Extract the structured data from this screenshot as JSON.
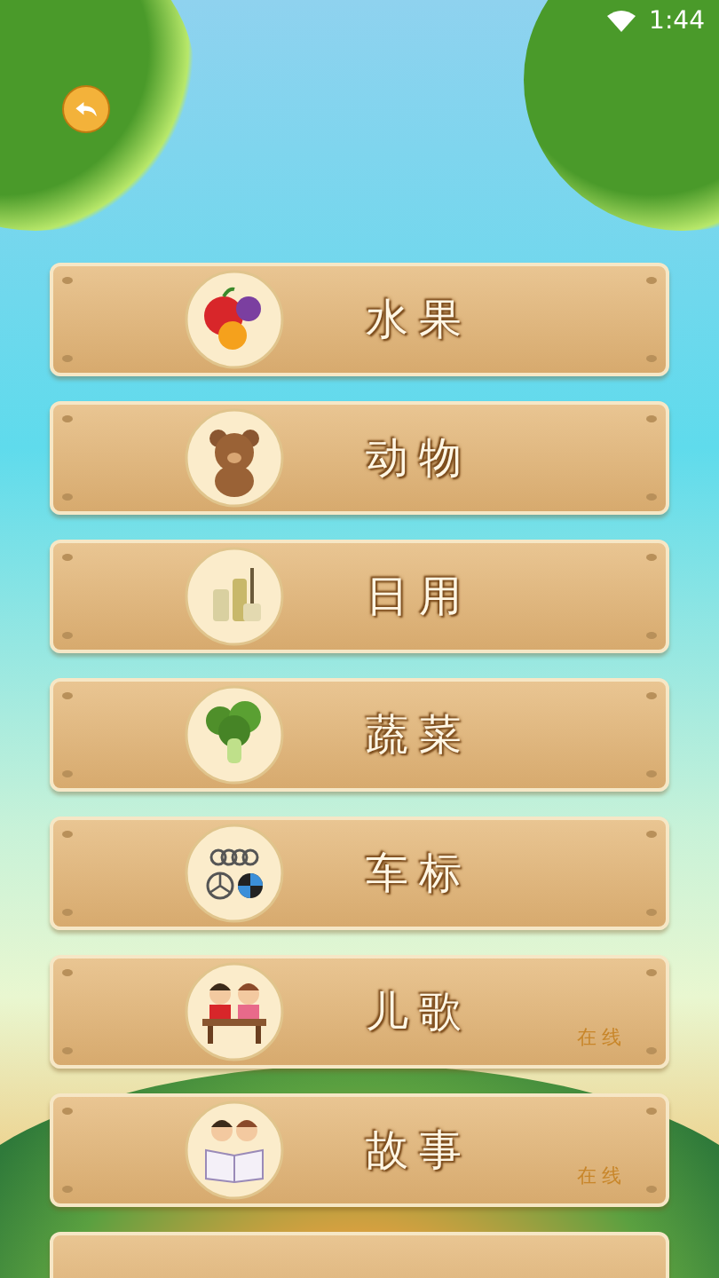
{
  "status_bar": {
    "time": "1:44"
  },
  "categories": [
    {
      "label": "水果"
    },
    {
      "label": "动物"
    },
    {
      "label": "日用"
    },
    {
      "label": "蔬菜"
    },
    {
      "label": "车标"
    },
    {
      "label": "儿歌",
      "status": "在线"
    },
    {
      "label": "故事",
      "status": "在线"
    }
  ]
}
